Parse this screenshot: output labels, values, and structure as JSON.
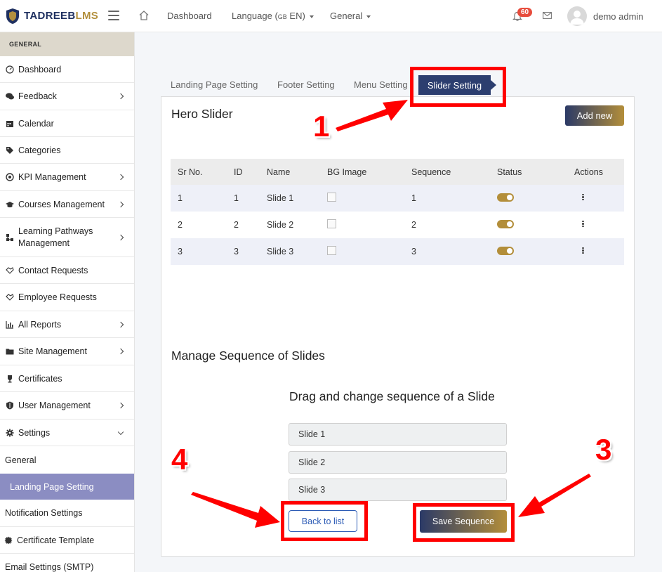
{
  "brand": {
    "name_main": "TADREEB",
    "name_accent": "LMS",
    "primary": "#1f3060",
    "accent": "#b3903e"
  },
  "topnav": {
    "dashboard": "Dashboard",
    "language_label": "Language (",
    "language_code": "GB",
    "language_tail": " EN)",
    "general": "General",
    "notification_count": "60",
    "user": "demo admin"
  },
  "sidebar": {
    "section": "GENERAL",
    "items": [
      {
        "label": "Dashboard",
        "icon": "dashboard-icon"
      },
      {
        "label": "Feedback",
        "icon": "comments-icon"
      },
      {
        "label": "Calendar",
        "icon": "calendar-icon"
      },
      {
        "label": "Categories",
        "icon": "tags-icon"
      },
      {
        "label": "KPI Management",
        "icon": "target-icon"
      },
      {
        "label": "Courses Management",
        "icon": "graduation-cap-icon"
      },
      {
        "label": "Learning Pathways Management",
        "icon": "sitemap-icon"
      },
      {
        "label": "Contact Requests",
        "icon": "handshake-icon"
      },
      {
        "label": "Employee Requests",
        "icon": "handshake-icon"
      },
      {
        "label": "All Reports",
        "icon": "bar-chart-icon"
      },
      {
        "label": "Site Management",
        "icon": "folder-icon"
      },
      {
        "label": "Certificates",
        "icon": "trophy-icon"
      },
      {
        "label": "User Management",
        "icon": "shield-icon"
      },
      {
        "label": "Settings",
        "icon": "gear-icon"
      }
    ],
    "sub_items": [
      "General",
      "Landing Page Setting",
      "Notification Settings",
      "Certificate Template",
      "Email Settings (SMTP)"
    ]
  },
  "tabs": {
    "landing": "Landing Page Setting",
    "footer": "Footer Setting",
    "menu": "Menu Setting",
    "slider": "Slider Setting"
  },
  "hero": {
    "title": "Hero Slider",
    "add_new": "Add new",
    "columns": [
      "Sr No.",
      "ID",
      "Name",
      "BG Image",
      "Sequence",
      "Status",
      "Actions"
    ],
    "rows": [
      {
        "sr": "1",
        "id": "1",
        "name": "Slide 1",
        "sequence": "1"
      },
      {
        "sr": "2",
        "id": "2",
        "name": "Slide 2",
        "sequence": "2"
      },
      {
        "sr": "3",
        "id": "3",
        "name": "Slide 3",
        "sequence": "3"
      }
    ]
  },
  "sequence": {
    "title": "Manage Sequence of Slides",
    "drag_title": "Drag and change sequence of a Slide",
    "slides": [
      "Slide 1",
      "Slide 2",
      "Slide 3"
    ],
    "back": "Back to list",
    "save": "Save Sequence"
  },
  "annotations": {
    "n1": "1",
    "n3": "3",
    "n4": "4",
    "color": "#ff0000"
  }
}
